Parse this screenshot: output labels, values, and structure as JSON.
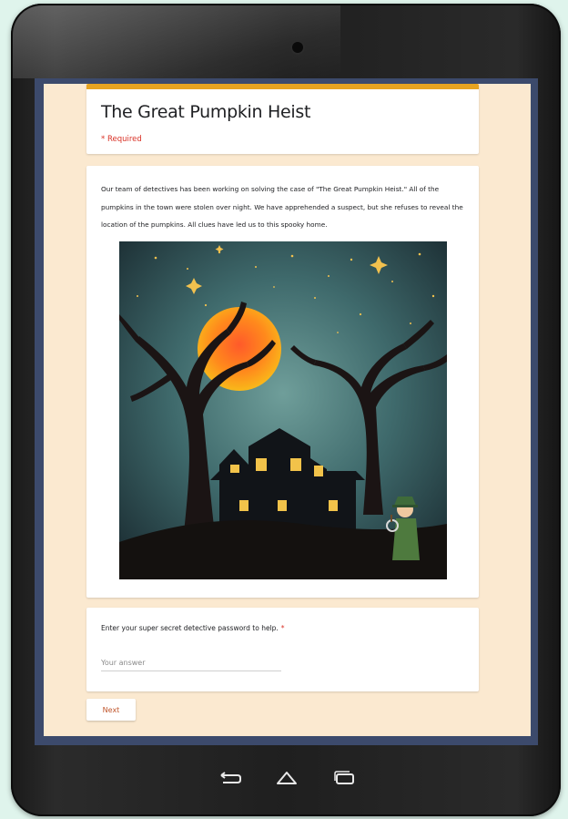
{
  "form": {
    "title": "The Great Pumpkin Heist",
    "required_note": "* Required",
    "description": "Our team of detectives has been working on solving the case of \"The Great Pumpkin Heist.\" All of the pumpkins in the town were stolen over night. We have apprehended a suspect, but she refuses to reveal the location of the pumpkins. All clues have led us to this spooky home.",
    "question": {
      "label": "Enter your super secret detective password to help.",
      "required_marker": "*",
      "placeholder": "Your answer",
      "value": ""
    },
    "next_label": "Next"
  },
  "colors": {
    "accent_bar": "#e6a321",
    "page_background": "#fbe9d0",
    "required_red": "#d93025",
    "next_text": "#c0562c"
  },
  "icons": {
    "camera": "front-camera-icon",
    "back": "back-arrow-icon",
    "home": "home-icon",
    "recents": "recent-apps-icon"
  }
}
